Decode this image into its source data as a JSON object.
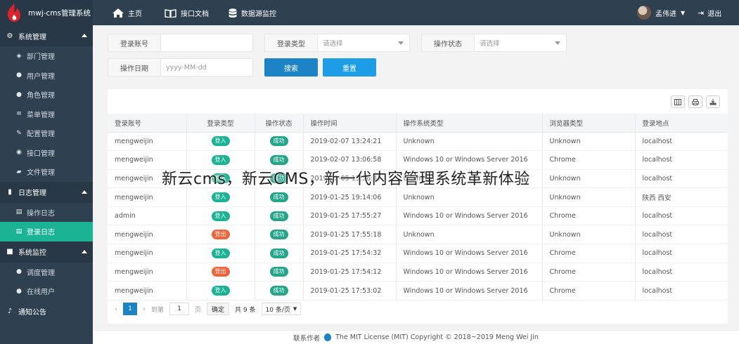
{
  "brand": {
    "name": "mwj-cms管理系统"
  },
  "topnav": [
    {
      "label": "主页",
      "icon": "home-icon"
    },
    {
      "label": "接口文档",
      "icon": "book-icon"
    },
    {
      "label": "数据源监控",
      "icon": "database-icon"
    }
  ],
  "user": {
    "name": "孟伟进",
    "logout": "退出"
  },
  "sidebar": {
    "groups": [
      {
        "label": "系统管理",
        "items": [
          "部门管理",
          "用户管理",
          "角色管理",
          "菜单管理",
          "配置管理",
          "接口管理",
          "文件管理"
        ]
      },
      {
        "label": "日志管理",
        "items": [
          "操作日志",
          "登录日志"
        ]
      },
      {
        "label": "系统监控",
        "items": [
          "调度管理",
          "在线用户"
        ]
      },
      {
        "label": "通知公告",
        "items": []
      }
    ],
    "active": "登录日志"
  },
  "search": {
    "account_label": "登录账号",
    "account_value": "",
    "type_label": "登录类型",
    "type_placeholder": "请选择",
    "status_label": "操作状态",
    "status_placeholder": "请选择",
    "date_label": "操作日期",
    "date_placeholder": "yyyy-MM-dd",
    "search_button": "搜索",
    "reset_button": "重置"
  },
  "table": {
    "headers": [
      "登录账号",
      "登录类型",
      "操作状态",
      "操作时间",
      "操作系统类型",
      "浏览器类型",
      "登录地点"
    ],
    "rows": [
      {
        "account": "mengweijin",
        "type": "登入",
        "status": "成功",
        "time": "2019-02-07 13:24:21",
        "os": "Unknown",
        "browser": "Unknown",
        "location": "localhost"
      },
      {
        "account": "mengweijin",
        "type": "登入",
        "status": "成功",
        "time": "2019-02-07 13:06:58",
        "os": "Windows 10 or Windows Server 2016",
        "browser": "Chrome",
        "location": "localhost"
      },
      {
        "account": "mengweijin",
        "type": "登入",
        "status": "成功",
        "time": "2019-02-05 15:36:47",
        "os": "Unknown",
        "browser": "Unknown",
        "location": "localhost"
      },
      {
        "account": "mengweijin",
        "type": "登入",
        "status": "成功",
        "time": "2019-01-25 19:14:06",
        "os": "Unknown",
        "browser": "Unknown",
        "location": "陕西 西安"
      },
      {
        "account": "admin",
        "type": "登入",
        "status": "成功",
        "time": "2019-01-25 17:55:27",
        "os": "Windows 10 or Windows Server 2016",
        "browser": "Chrome",
        "location": "localhost"
      },
      {
        "account": "mengweijin",
        "type": "登出",
        "status": "成功",
        "time": "2019-01-25 17:55:18",
        "os": "Unknown",
        "browser": "Unknown",
        "location": "localhost"
      },
      {
        "account": "mengweijin",
        "type": "登入",
        "status": "成功",
        "time": "2019-01-25 17:54:32",
        "os": "Windows 10 or Windows Server 2016",
        "browser": "Chrome",
        "location": "localhost"
      },
      {
        "account": "mengweijin",
        "type": "登出",
        "status": "成功",
        "time": "2019-01-25 17:54:12",
        "os": "Windows 10 or Windows Server 2016",
        "browser": "Chrome",
        "location": "localhost"
      },
      {
        "account": "mengweijin",
        "type": "登入",
        "status": "成功",
        "time": "2019-01-25 17:53:02",
        "os": "Windows 10 or Windows Server 2016",
        "browser": "Chrome",
        "location": "localhost"
      }
    ]
  },
  "pager": {
    "current": "1",
    "goto_label": "到第",
    "page_input": "1",
    "page_unit": "页",
    "confirm": "确定",
    "total": "共 9 条",
    "page_size": "10 条/页"
  },
  "footer": {
    "contact": "联系作者",
    "license": "The MIT License (MIT) Copyright © 2018~2019 Meng Wei Jin"
  },
  "watermark": "新云cms，新云CMS，新一代内容管理系统革新体验",
  "colors": {
    "sidebar": "#2f4050",
    "accent": "#1ab394",
    "primary": "#1c84c6",
    "logout_badge": "#f0643c"
  }
}
